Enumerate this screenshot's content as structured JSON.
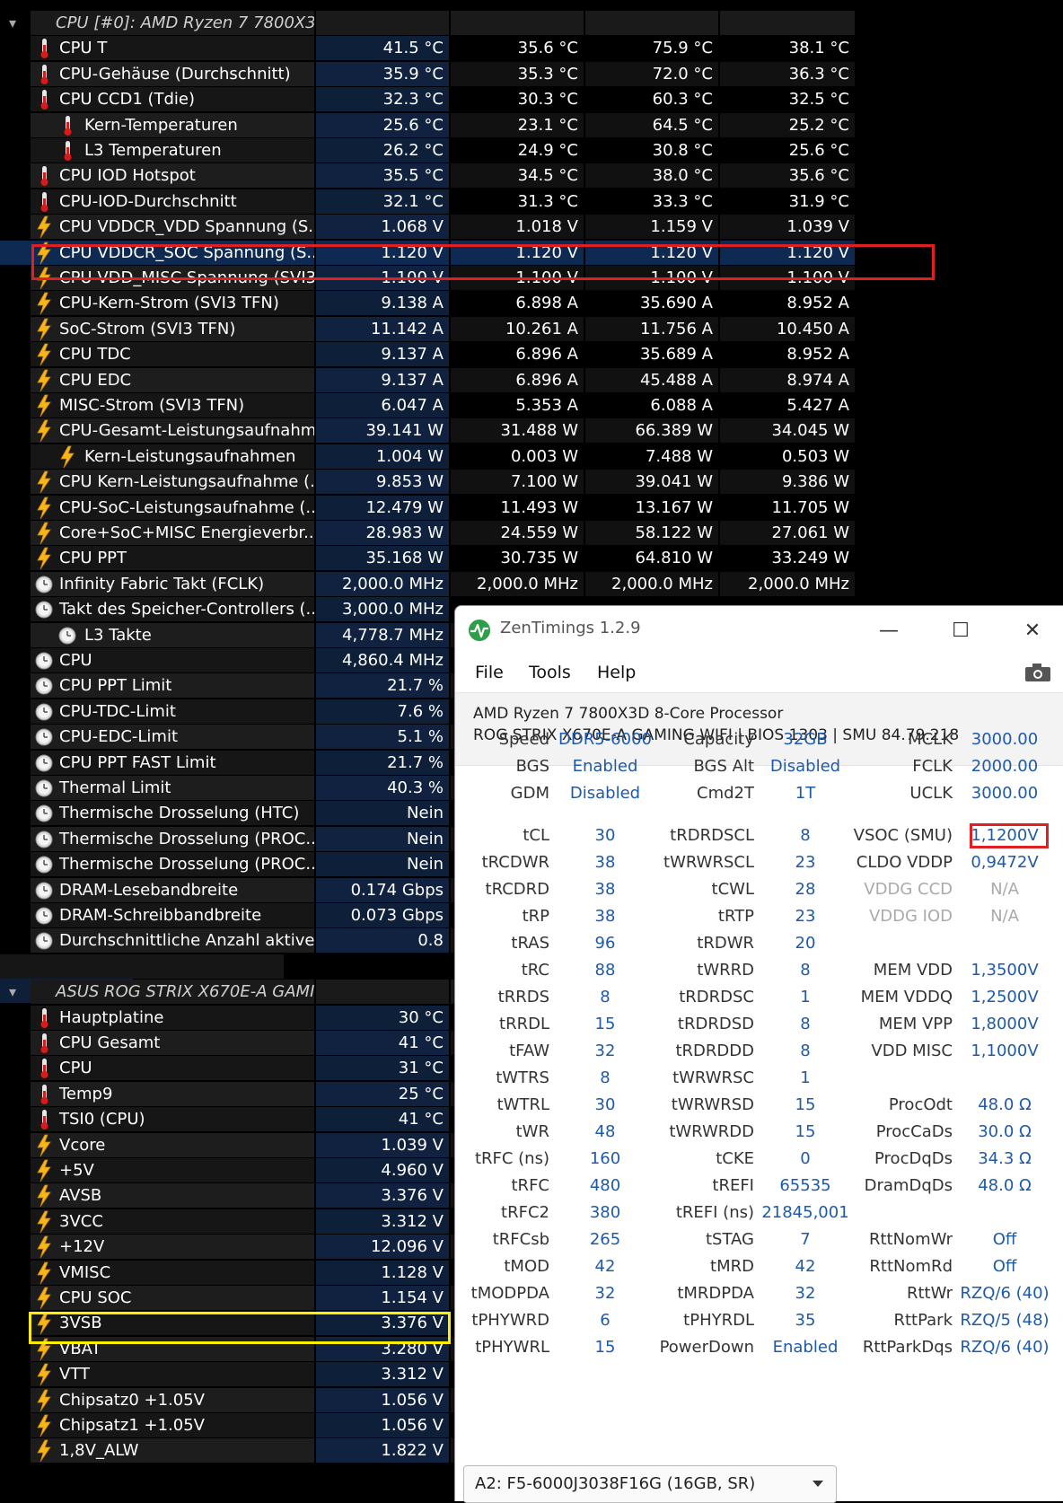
{
  "hwinfo": {
    "cpu_group": "CPU [#0]: AMD Ryzen 7 7800X3...",
    "board_group": "ASUS ROG STRIX X670E-A GAMI...",
    "rows": [
      {
        "label": "CPU T",
        "v1": "41.5 °C",
        "v2": "35.6 °C",
        "v3": "75.9 °C",
        "v4": "38.1 °C",
        "icon": "thermometer-icon"
      },
      {
        "label": "CPU-Gehäuse (Durchschnitt)",
        "v1": "35.9 °C",
        "v2": "35.3 °C",
        "v3": "72.0 °C",
        "v4": "36.3 °C",
        "icon": "thermometer-icon"
      },
      {
        "label": "CPU CCD1 (Tdie)",
        "v1": "32.3 °C",
        "v2": "30.3 °C",
        "v3": "60.3 °C",
        "v4": "32.5 °C",
        "icon": "thermometer-icon"
      },
      {
        "label": "Kern-Temperaturen",
        "v1": "25.6 °C",
        "v2": "23.1 °C",
        "v3": "64.5 °C",
        "v4": "25.2 °C",
        "icon": "thermometer-icon",
        "expand": true
      },
      {
        "label": "L3 Temperaturen",
        "v1": "26.2 °C",
        "v2": "24.9 °C",
        "v3": "30.8 °C",
        "v4": "25.6 °C",
        "icon": "thermometer-icon",
        "expand": true
      },
      {
        "label": "CPU IOD Hotspot",
        "v1": "35.5 °C",
        "v2": "34.5 °C",
        "v3": "38.0 °C",
        "v4": "35.6 °C",
        "icon": "thermometer-icon"
      },
      {
        "label": "CPU-IOD-Durchschnitt",
        "v1": "32.1 °C",
        "v2": "31.3 °C",
        "v3": "33.3 °C",
        "v4": "31.9 °C",
        "icon": "thermometer-icon"
      },
      {
        "label": "CPU VDDCR_VDD Spannung (S...",
        "v1": "1.068 V",
        "v2": "1.018 V",
        "v3": "1.159 V",
        "v4": "1.039 V",
        "icon": "lightning-icon"
      },
      {
        "label": "CPU VDDCR_SOC Spannung (S...",
        "v1": "1.120 V",
        "v2": "1.120 V",
        "v3": "1.120 V",
        "v4": "1.120 V",
        "icon": "lightning-icon",
        "selected": true
      },
      {
        "label": "CPU VDD_MISC Spannung (SVI3...",
        "v1": "1.100 V",
        "v2": "1.100 V",
        "v3": "1.100 V",
        "v4": "1.100 V",
        "icon": "lightning-icon"
      },
      {
        "label": "CPU-Kern-Strom (SVI3 TFN)",
        "v1": "9.138 A",
        "v2": "6.898 A",
        "v3": "35.690 A",
        "v4": "8.952 A",
        "icon": "lightning-icon"
      },
      {
        "label": "SoC-Strom (SVI3 TFN)",
        "v1": "11.142 A",
        "v2": "10.261 A",
        "v3": "11.756 A",
        "v4": "10.450 A",
        "icon": "lightning-icon"
      },
      {
        "label": "CPU TDC",
        "v1": "9.137 A",
        "v2": "6.896 A",
        "v3": "35.689 A",
        "v4": "8.952 A",
        "icon": "lightning-icon"
      },
      {
        "label": "CPU EDC",
        "v1": "9.137 A",
        "v2": "6.896 A",
        "v3": "45.488 A",
        "v4": "8.974 A",
        "icon": "lightning-icon"
      },
      {
        "label": "MISC-Strom (SVI3 TFN)",
        "v1": "6.047 A",
        "v2": "5.353 A",
        "v3": "6.088 A",
        "v4": "5.427 A",
        "icon": "lightning-icon"
      },
      {
        "label": "CPU-Gesamt-Leistungsaufnahme",
        "v1": "39.141 W",
        "v2": "31.488 W",
        "v3": "66.389 W",
        "v4": "34.045 W",
        "icon": "lightning-icon"
      },
      {
        "label": "Kern-Leistungsaufnahmen",
        "v1": "1.004 W",
        "v2": "0.003 W",
        "v3": "7.488 W",
        "v4": "0.503 W",
        "icon": "lightning-icon",
        "expand": true
      },
      {
        "label": "CPU Kern-Leistungsaufnahme (...",
        "v1": "9.853 W",
        "v2": "7.100 W",
        "v3": "39.041 W",
        "v4": "9.386 W",
        "icon": "lightning-icon"
      },
      {
        "label": "CPU-SoC-Leistungsaufnahme (...",
        "v1": "12.479 W",
        "v2": "11.493 W",
        "v3": "13.167 W",
        "v4": "11.705 W",
        "icon": "lightning-icon"
      },
      {
        "label": "Core+SoC+MISC Energieverbr...",
        "v1": "28.983 W",
        "v2": "24.559 W",
        "v3": "58.122 W",
        "v4": "27.061 W",
        "icon": "lightning-icon"
      },
      {
        "label": "CPU PPT",
        "v1": "35.168 W",
        "v2": "30.735 W",
        "v3": "64.810 W",
        "v4": "33.249 W",
        "icon": "lightning-icon"
      },
      {
        "label": "Infinity Fabric Takt (FCLK)",
        "v1": "2,000.0 MHz",
        "v2": "2,000.0 MHz",
        "v3": "2,000.0 MHz",
        "v4": "2,000.0 MHz",
        "icon": "clock-icon"
      },
      {
        "label": "Takt des Speicher-Controllers (...",
        "v1": "3,000.0 MHz",
        "v2": "",
        "v3": "",
        "v4": "",
        "icon": "clock-icon"
      },
      {
        "label": "L3 Takte",
        "v1": "4,778.7 MHz",
        "v2": "",
        "v3": "",
        "v4": "",
        "icon": "clock-icon",
        "expand": true
      },
      {
        "label": "CPU",
        "v1": "4,860.4 MHz",
        "v2": "",
        "v3": "",
        "v4": "",
        "icon": "clock-icon"
      },
      {
        "label": "CPU PPT Limit",
        "v1": "21.7 %",
        "v2": "",
        "v3": "",
        "v4": "",
        "icon": "clock-icon"
      },
      {
        "label": "CPU-TDC-Limit",
        "v1": "7.6 %",
        "v2": "",
        "v3": "",
        "v4": "",
        "icon": "clock-icon"
      },
      {
        "label": "CPU-EDC-Limit",
        "v1": "5.1 %",
        "v2": "",
        "v3": "",
        "v4": "",
        "icon": "clock-icon"
      },
      {
        "label": "CPU PPT FAST Limit",
        "v1": "21.7 %",
        "v2": "",
        "v3": "",
        "v4": "",
        "icon": "clock-icon"
      },
      {
        "label": "Thermal Limit",
        "v1": "40.3 %",
        "v2": "",
        "v3": "",
        "v4": "",
        "icon": "clock-icon"
      },
      {
        "label": "Thermische Drosselung (HTC)",
        "v1": "Nein",
        "v2": "",
        "v3": "",
        "v4": "",
        "icon": "clock-icon"
      },
      {
        "label": "Thermische Drosselung (PROC...",
        "v1": "Nein",
        "v2": "",
        "v3": "",
        "v4": "",
        "icon": "clock-icon"
      },
      {
        "label": "Thermische Drosselung (PROC...",
        "v1": "Nein",
        "v2": "",
        "v3": "",
        "v4": "",
        "icon": "clock-icon"
      },
      {
        "label": "DRAM-Lesebandbreite",
        "v1": "0.174 Gbps",
        "v2": "",
        "v3": "",
        "v4": "",
        "icon": "clock-icon"
      },
      {
        "label": "DRAM-Schreibbandbreite",
        "v1": "0.073 Gbps",
        "v2": "",
        "v3": "",
        "v4": "",
        "icon": "clock-icon"
      },
      {
        "label": "Durchschnittliche Anzahl aktive...",
        "v1": "0.8",
        "v2": "",
        "v3": "",
        "v4": "",
        "icon": "clock-icon"
      }
    ],
    "board_rows": [
      {
        "label": "Hauptplatine",
        "v1": "30 °C",
        "icon": "thermometer-icon"
      },
      {
        "label": "CPU Gesamt",
        "v1": "41 °C",
        "icon": "thermometer-icon"
      },
      {
        "label": "CPU",
        "v1": "31 °C",
        "icon": "thermometer-icon"
      },
      {
        "label": "Temp9",
        "v1": "25 °C",
        "icon": "thermometer-icon"
      },
      {
        "label": "TSI0 (CPU)",
        "v1": "41 °C",
        "icon": "thermometer-icon"
      },
      {
        "label": "Vcore",
        "v1": "1.039 V",
        "icon": "lightning-icon"
      },
      {
        "label": "+5V",
        "v1": "4.960 V",
        "icon": "lightning-icon"
      },
      {
        "label": "AVSB",
        "v1": "3.376 V",
        "icon": "lightning-icon"
      },
      {
        "label": "3VCC",
        "v1": "3.312 V",
        "icon": "lightning-icon"
      },
      {
        "label": "+12V",
        "v1": "12.096 V",
        "icon": "lightning-icon"
      },
      {
        "label": "VMISC",
        "v1": "1.128 V",
        "icon": "lightning-icon"
      },
      {
        "label": "CPU SOC",
        "v1": "1.154 V",
        "icon": "lightning-icon"
      },
      {
        "label": "3VSB",
        "v1": "3.376 V",
        "icon": "lightning-icon"
      },
      {
        "label": "VBAT",
        "v1": "3.280 V",
        "icon": "lightning-icon"
      },
      {
        "label": "VTT",
        "v1": "3.312 V",
        "icon": "lightning-icon"
      },
      {
        "label": "Chipsatz0 +1.05V",
        "v1": "1.056 V",
        "icon": "lightning-icon"
      },
      {
        "label": "Chipsatz1 +1.05V",
        "v1": "1.056 V",
        "icon": "lightning-icon"
      },
      {
        "label": "1,8V_ALW",
        "v1": "1.822 V",
        "icon": "lightning-icon"
      }
    ]
  },
  "zentimings": {
    "title": "ZenTimings 1.2.9",
    "menu": [
      "File",
      "Tools",
      "Help"
    ],
    "cpu": "AMD Ryzen 7 7800X3D 8-Core Processor",
    "board": "ROG STRIX X670E-A GAMING WIFI | BIOS 1303 | SMU 84.79.218",
    "top": [
      [
        "Speed",
        "DDR5-6000",
        "Capacity",
        "32GB",
        "MCLK",
        "3000.00"
      ],
      [
        "BGS",
        "Enabled",
        "BGS Alt",
        "Disabled",
        "FCLK",
        "2000.00"
      ],
      [
        "GDM",
        "Disabled",
        "Cmd2T",
        "1T",
        "UCLK",
        "3000.00"
      ]
    ],
    "timings": [
      [
        "tCL",
        "30",
        "tRDRDSCL",
        "8",
        "VSOC (SMU)",
        "1,1200V"
      ],
      [
        "tRCDWR",
        "38",
        "tWRWRSCL",
        "23",
        "CLDO VDDP",
        "0,9472V"
      ],
      [
        "tRCDRD",
        "38",
        "tCWL",
        "28",
        "VDDG CCD",
        "N/A"
      ],
      [
        "tRP",
        "38",
        "tRTP",
        "23",
        "VDDG IOD",
        "N/A"
      ],
      [
        "tRAS",
        "96",
        "tRDWR",
        "20",
        "",
        ""
      ],
      [
        "tRC",
        "88",
        "tWRRD",
        "8",
        "MEM VDD",
        "1,3500V"
      ],
      [
        "tRRDS",
        "8",
        "tRDRDSC",
        "1",
        "MEM VDDQ",
        "1,2500V"
      ],
      [
        "tRRDL",
        "15",
        "tRDRDSD",
        "8",
        "MEM VPP",
        "1,8000V"
      ],
      [
        "tFAW",
        "32",
        "tRDRDDD",
        "8",
        "VDD MISC",
        "1,1000V"
      ],
      [
        "tWTRS",
        "8",
        "tWRWRSC",
        "1",
        "",
        ""
      ],
      [
        "tWTRL",
        "30",
        "tWRWRSD",
        "15",
        "ProcOdt",
        "48.0 Ω"
      ],
      [
        "tWR",
        "48",
        "tWRWRDD",
        "15",
        "ProcCaDs",
        "30.0 Ω"
      ],
      [
        "tRFC (ns)",
        "160",
        "tCKE",
        "0",
        "ProcDqDs",
        "34.3 Ω"
      ],
      [
        "tRFC",
        "480",
        "tREFI",
        "65535",
        "DramDqDs",
        "48.0 Ω"
      ],
      [
        "tRFC2",
        "380",
        "tREFI (ns)",
        "21845,001",
        "",
        ""
      ],
      [
        "tRFCsb",
        "265",
        "tSTAG",
        "7",
        "RttNomWr",
        "Off"
      ],
      [
        "tMOD",
        "42",
        "tMRD",
        "42",
        "RttNomRd",
        "Off"
      ],
      [
        "tMODPDA",
        "32",
        "tMRDPDA",
        "32",
        "RttWr",
        "RZQ/6 (40)"
      ],
      [
        "tPHYWRD",
        "6",
        "tPHYRDL",
        "35",
        "RttPark",
        "RZQ/5 (48)"
      ],
      [
        "tPHYWRL",
        "15",
        "PowerDown",
        "Enabled",
        "RttParkDqs",
        "RZQ/6 (40)"
      ]
    ],
    "dimm": "A2: F5-6000J3038F16G (16GB, SR)"
  },
  "colors": {
    "highlight_red": "#e02020",
    "highlight_yellow": "#ffee00",
    "value_blue": "#1f5aa8"
  }
}
